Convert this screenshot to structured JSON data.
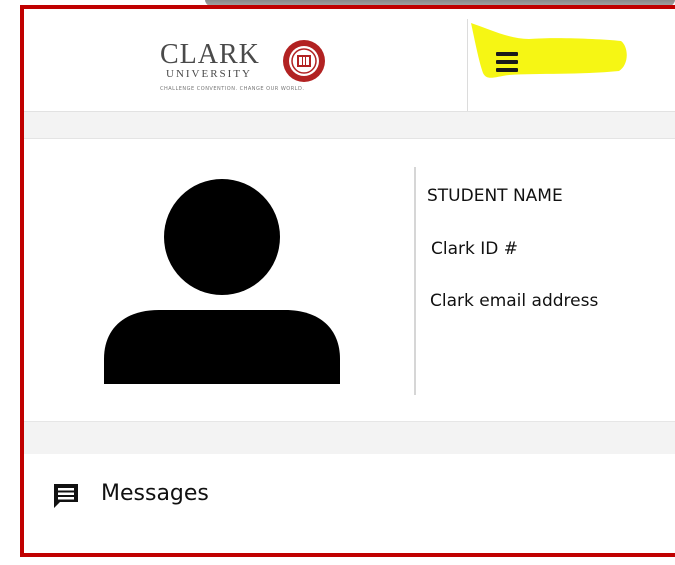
{
  "header": {
    "logo": {
      "wordmark": "CLARK",
      "subtitle": "UNIVERSITY",
      "tagline": "CHALLENGE CONVENTION. CHANGE OUR WORLD."
    },
    "menu_icon": "hamburger-menu-icon",
    "highlight_color": "#f5f500"
  },
  "profile": {
    "avatar_icon": "user-avatar-icon",
    "name_label": "STUDENT NAME",
    "id_label": "Clark ID #",
    "email_label": "Clark email address"
  },
  "messages": {
    "icon": "message-icon",
    "label": "Messages"
  },
  "colors": {
    "frame_red": "#c00000",
    "brand_red": "#b22222",
    "text": "#111111",
    "band_gray": "#f3f3f3"
  }
}
